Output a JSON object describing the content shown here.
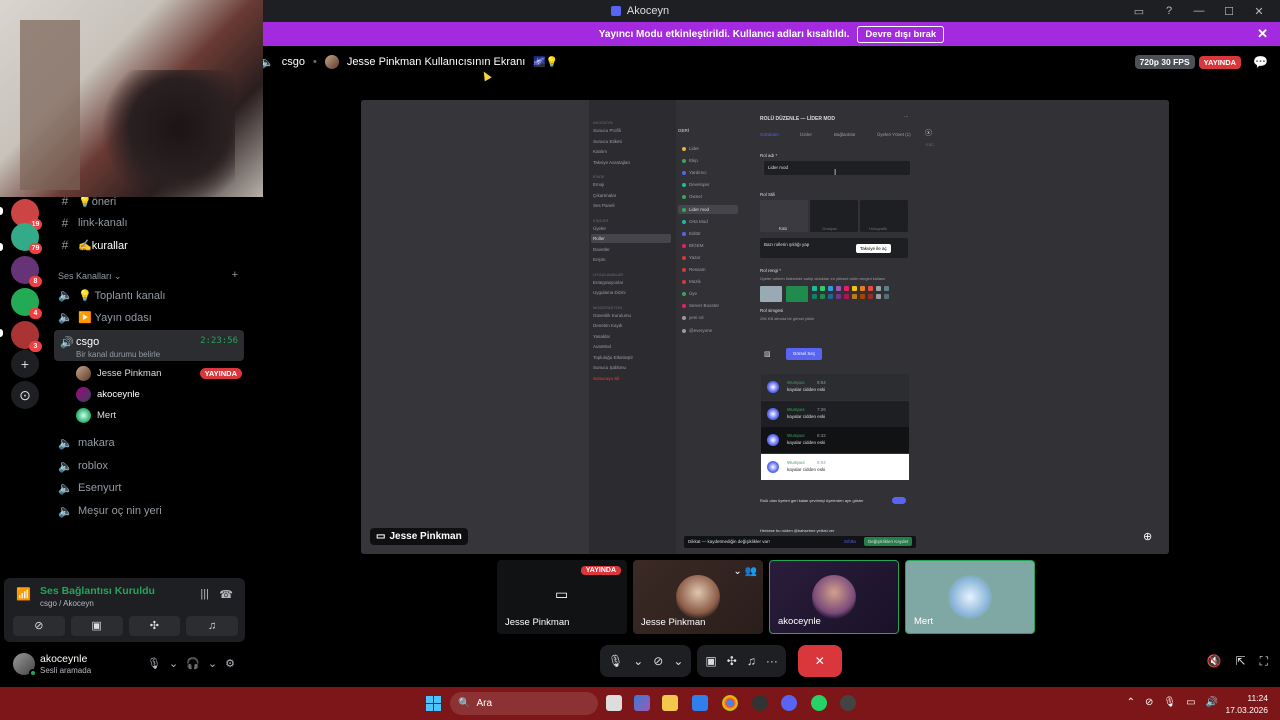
{
  "window": {
    "title": "Akoceyn"
  },
  "notice": {
    "text": "Yayıncı Modu etkinleştirildi. Kullanıcı adları kısaltıldı.",
    "button": "Devre dışı bırak"
  },
  "servers": [
    {
      "badge": "19",
      "color": "#c44"
    },
    {
      "badge": "79",
      "color": "#3a8"
    },
    {
      "badge": "8",
      "color": "#637"
    },
    {
      "badge": "4",
      "color": "#2a5"
    },
    {
      "badge": "3",
      "color": "#a33"
    }
  ],
  "channels": {
    "text": [
      {
        "icon": "#",
        "label": "💡öneri"
      },
      {
        "icon": "#",
        "label": "link-kanalı"
      },
      {
        "icon": "#",
        "label": "✍️kurallar"
      }
    ],
    "voice_category": "Ses Kanalları",
    "voice": [
      {
        "label": "💡 Toplantı kanalı"
      },
      {
        "label": "▶️ Yayın odası"
      }
    ],
    "active": {
      "name": "csgo",
      "time": "2:23:56",
      "status": "Bir kanal durumu belirle",
      "members": [
        {
          "name": "Jesse Pinkman",
          "live": "YAYINDA"
        },
        {
          "name": "akoceynle"
        },
        {
          "name": "Mert"
        }
      ]
    },
    "voice_after": [
      {
        "label": "makara"
      },
      {
        "label": "roblox"
      },
      {
        "label": "Esenyurt"
      },
      {
        "label": "Meşur oç nin yeri"
      }
    ]
  },
  "voice_connection": {
    "status": "Ses Bağlantısı Kuruldu",
    "sub": "csgo / Akoceyn"
  },
  "user": {
    "name": "akoceynle",
    "status": "Sesli aramada"
  },
  "stage": {
    "channel": "csgo",
    "stream_title": "Jesse Pinkman Kullanıcısının Ekranı",
    "quality": "720p 30 FPS",
    "live": "YAYINDA",
    "stream_label": "Jesse Pinkman"
  },
  "share": {
    "server": "AKOCEYN",
    "left_menu": [
      {
        "h": true,
        "t": "AKOCEYN"
      },
      {
        "t": "Sunucu Profili"
      },
      {
        "t": "Sunucu Etiketi"
      },
      {
        "t": "Katılım"
      },
      {
        "t": "Takviye Avantajları"
      },
      {
        "h": true,
        "t": "İFADE"
      },
      {
        "t": "Emoji"
      },
      {
        "t": "Çıkartmalar"
      },
      {
        "t": "Ses Paneli"
      },
      {
        "h": true,
        "t": "KİŞİLER"
      },
      {
        "t": "Üyeler"
      },
      {
        "t": "Roller",
        "sel": true
      },
      {
        "t": "Davetler"
      },
      {
        "t": "Erişim"
      },
      {
        "h": true,
        "t": "UYGULAMALAR"
      },
      {
        "t": "Entegrasyonlar"
      },
      {
        "t": "Uygulama Dizini"
      },
      {
        "h": true,
        "t": "MODERASYON"
      },
      {
        "t": "Güvenlik Kurulumu"
      },
      {
        "t": "Denetim Kaydı"
      },
      {
        "t": "Yasaklar"
      },
      {
        "t": "AutoMod"
      },
      {
        "t": "Topluluğu Etkinleştir"
      },
      {
        "t": "Sunucu Şablonu"
      },
      {
        "t": "Sunucuyu Sil",
        "red": true
      }
    ],
    "back": "GERİ",
    "roles": [
      {
        "t": "Lider",
        "c": "#f0b232"
      },
      {
        "t": "Ekip",
        "c": "#3ba55d"
      },
      {
        "t": "Yardımcı",
        "c": "#5865f2"
      },
      {
        "t": "Developer",
        "c": "#1abc9c"
      },
      {
        "t": "Owner",
        "c": "#3ba55d"
      },
      {
        "t": "Lider mod",
        "c": "#3ba55d",
        "sel": true
      },
      {
        "t": "Orta Mod",
        "c": "#1abc9c"
      },
      {
        "t": "Editör",
        "c": "#5865f2"
      },
      {
        "t": "BİGEM",
        "c": "#e91e63"
      },
      {
        "t": "Yazar",
        "c": "#da373c"
      },
      {
        "t": "Ressam",
        "c": "#da373c"
      },
      {
        "t": "Müzik",
        "c": "#da373c"
      },
      {
        "t": "Üye",
        "c": "#3ba55d"
      },
      {
        "t": "Server Booster",
        "c": "#e91e63"
      },
      {
        "t": "yeni rol",
        "c": "#999"
      },
      {
        "t": "@everyone",
        "c": "#999"
      }
    ],
    "role_title": "ROLÜ DÜZENLE — LİDER MOD",
    "tabs": [
      "Görünüm",
      "İzinler",
      "Bağlantılar",
      "Üyeleri Yönet (1)"
    ],
    "esc": "ESC",
    "role_name_label": "Rol adı *",
    "role_name_value": "Lider mod",
    "role_style_label": "Rol Stili",
    "style_names": [
      "Katı",
      "Gradyan",
      "Holografik"
    ],
    "boost_text": "Bazı rollerin şıklığı yap",
    "boost_btn": "Takviye ile aç",
    "color_label": "Rol rengi *",
    "color_sub": "Üyeler rollerin listesinde sahip oldukları en yüksek rolün rengini kullanır",
    "icon_label": "Rol simgesi",
    "icon_sub": "256 KB altında bir görsel yükle",
    "select_img": "Görsel Seç",
    "preview": [
      {
        "name": "Wumpus",
        "time": "9:04",
        "text": "kayalar cidden eski"
      },
      {
        "name": "Wumpus",
        "time": "7:26",
        "text": "kayalar cidden eski"
      },
      {
        "name": "Wumpus",
        "time": "8:32",
        "text": "kayalar cidden eski"
      },
      {
        "name": "Wumpus",
        "time": "9:04",
        "text": "kayalar cidden eski"
      }
    ],
    "toggle_text": "Rolü olan üyeleri geri kalan çevrimiçi üyelerden ayrı göster",
    "toggle_text2": "Herkese bu rolden @bahsetme yetkisi ver",
    "save_warning": "Dikkat — kaydetmediğin değişiklikler var!",
    "reset": "Sıfırla",
    "save": "Değişiklikleri Kaydet"
  },
  "tiles": [
    {
      "name": "Jesse Pinkman",
      "live": "YAYINDA"
    },
    {
      "name": "Jesse Pinkman"
    },
    {
      "name": "akoceynle"
    },
    {
      "name": "Mert"
    }
  ],
  "taskbar": {
    "search": "Ara",
    "time": "11:24",
    "date": "17.03.2026"
  },
  "colors": {
    "accent": "#5865f2",
    "live": "#da373c",
    "green": "#23a55a",
    "notice": "#a42ae0",
    "taskbar": "#7d1618"
  }
}
